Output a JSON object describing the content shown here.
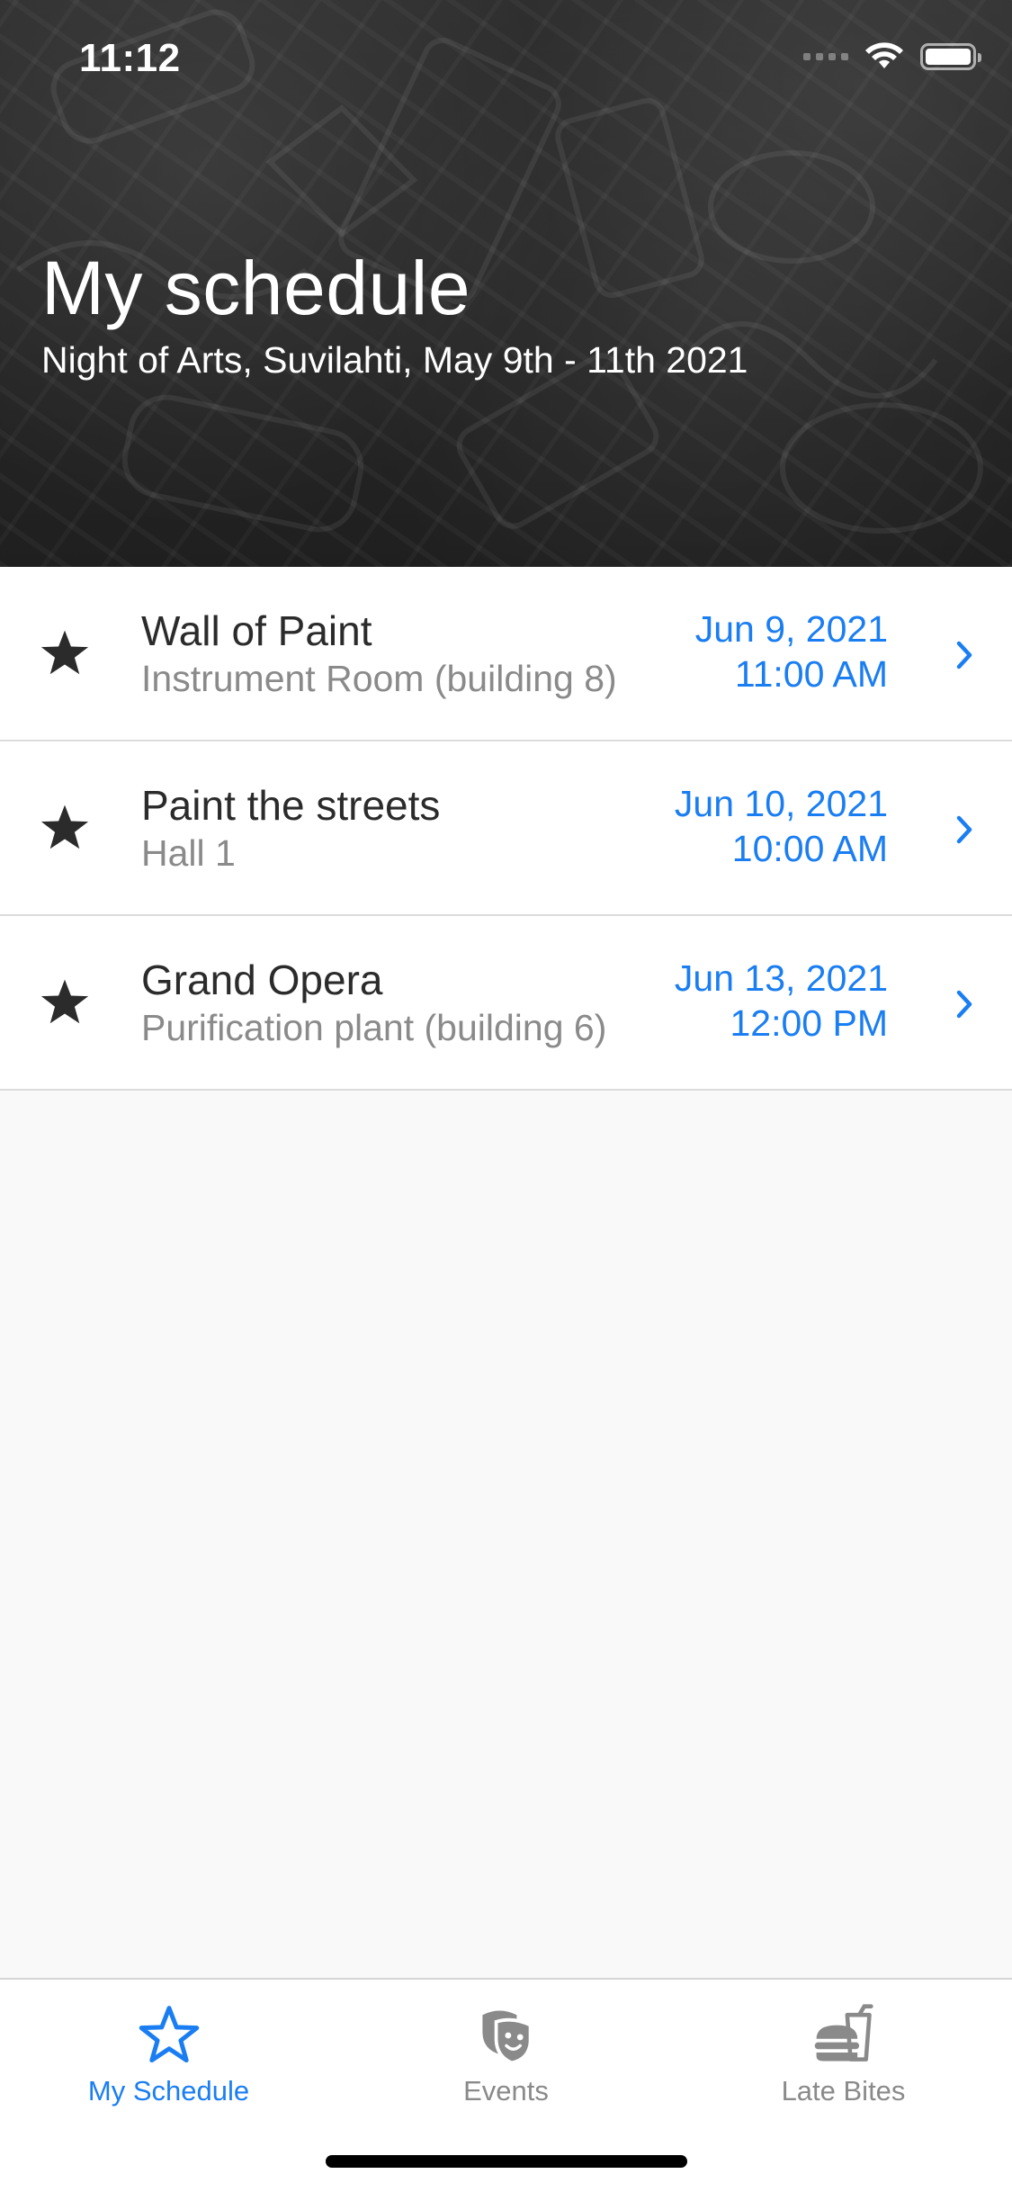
{
  "status_bar": {
    "time": "11:12",
    "wifi_icon": "wifi-icon",
    "battery_icon": "battery-icon"
  },
  "header": {
    "title": "My schedule",
    "subtitle": "Night of Arts, Suvilahti, May 9th - 11th 2021"
  },
  "events": [
    {
      "icon": "star-filled-icon",
      "title": "Wall of Paint",
      "location": "Instrument Room (building 8)",
      "date": "Jun 9, 2021",
      "time": "11:00 AM"
    },
    {
      "icon": "star-filled-icon",
      "title": "Paint the streets",
      "location": "Hall 1",
      "date": "Jun 10, 2021",
      "time": "10:00 AM"
    },
    {
      "icon": "star-filled-icon",
      "title": "Grand Opera",
      "location": "Purification plant (building 6)",
      "date": "Jun 13, 2021",
      "time": "12:00 PM"
    }
  ],
  "tabs": [
    {
      "label": "My Schedule",
      "icon": "star-outline-icon",
      "active": true
    },
    {
      "label": "Events",
      "icon": "theater-masks-icon",
      "active": false
    },
    {
      "label": "Late Bites",
      "icon": "burger-drink-icon",
      "active": false
    }
  ],
  "colors": {
    "accent": "#1a7ef2",
    "header_bg": "#262626",
    "title_text": "#2b2b2b",
    "secondary_text": "#8a8a8a",
    "list_bg": "#f9f9f9"
  }
}
